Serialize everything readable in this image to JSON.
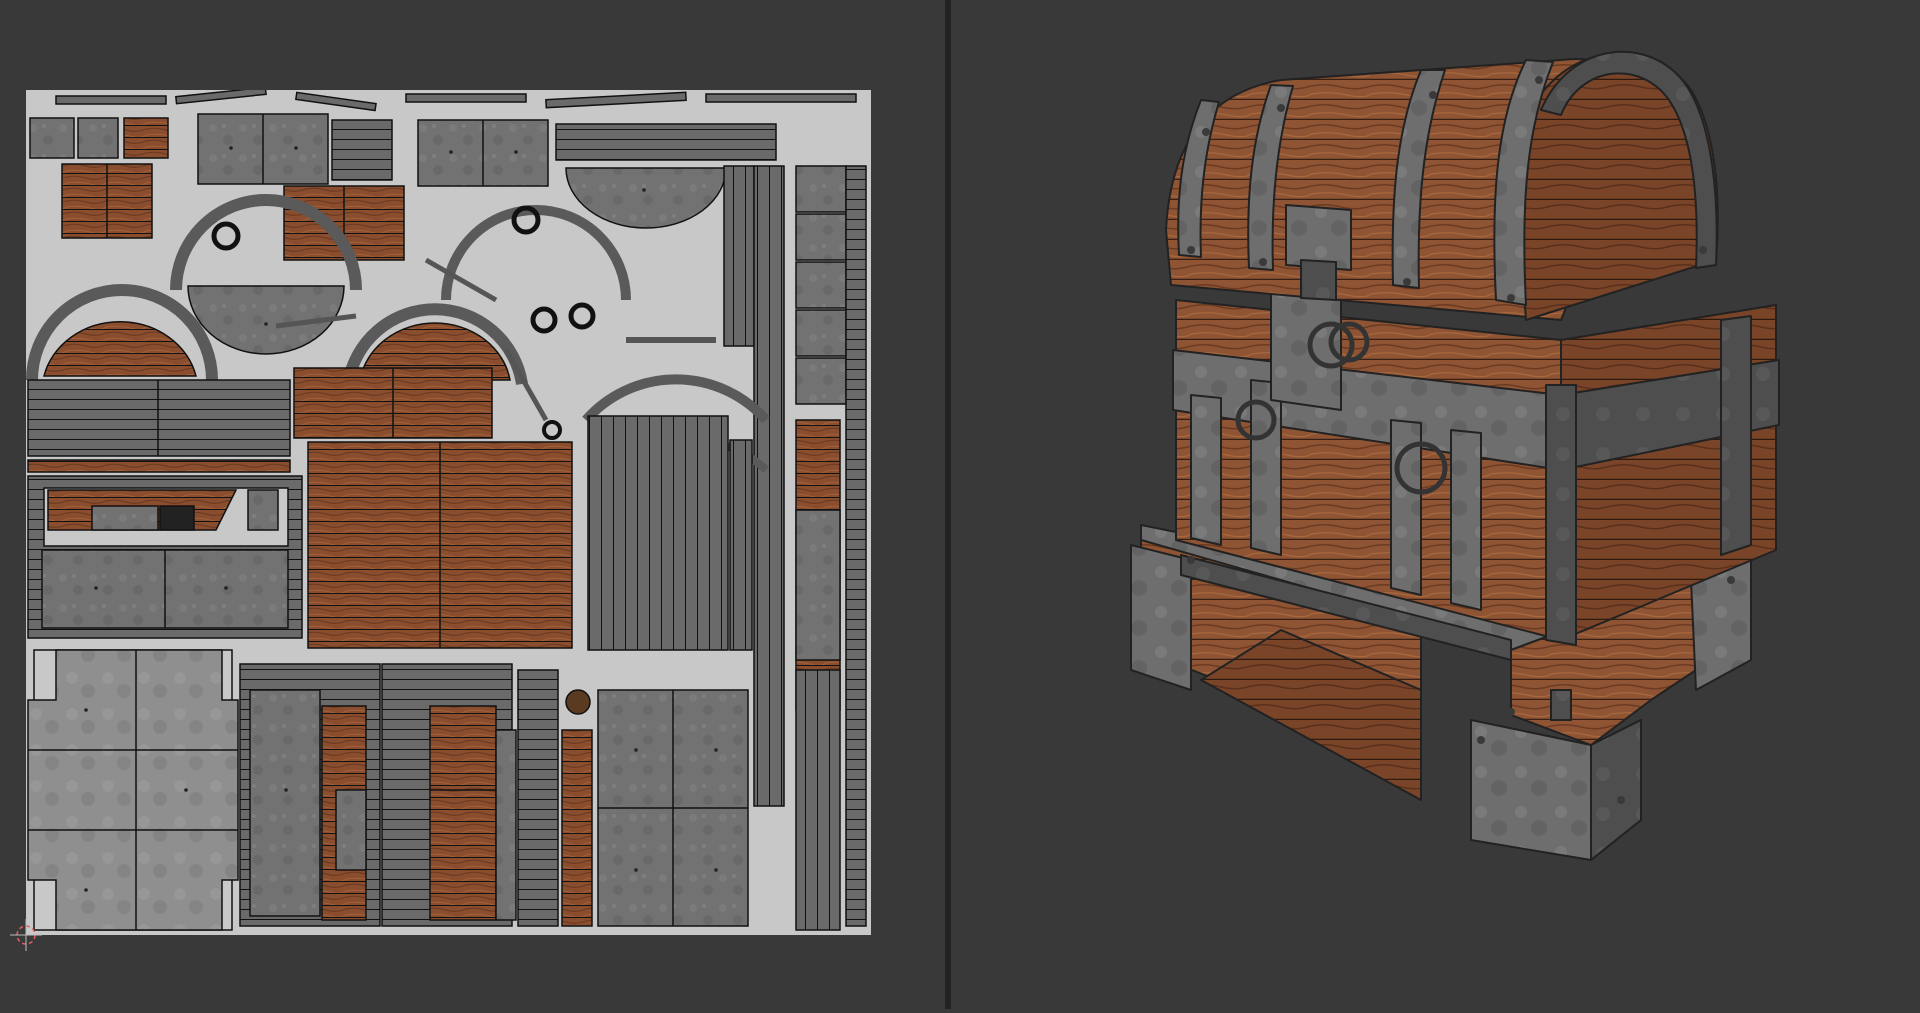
{
  "editors": {
    "left": "uv-image-editor",
    "right": "3d-viewport"
  },
  "uv_editor": {
    "content": "texture-atlas-with-uv-islands"
  },
  "viewport": {
    "object": "treasure-chest",
    "shading": "textured"
  },
  "colors": {
    "background": "#393939",
    "divider": "#232323",
    "uv_canvas": "#c8c8c8",
    "wood": "#8a4e2e",
    "wood_dark": "#5e3220",
    "iron": "#6d6d6d",
    "iron_dark": "#3a3a3a",
    "uv_edge": "#111111"
  },
  "icons": {
    "uv_cursor": "crosshair-2d-cursor-icon"
  }
}
